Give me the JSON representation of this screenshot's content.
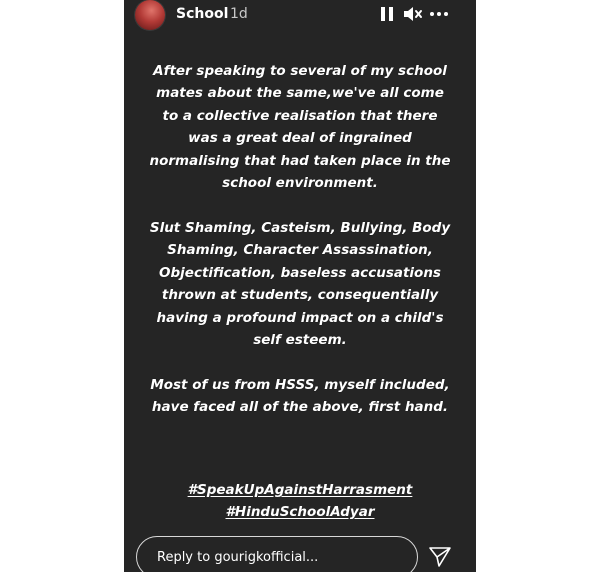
{
  "header": {
    "username": "School",
    "time_ago": "1d",
    "icons": [
      "avatar",
      "pause-icon",
      "mute-icon",
      "more-icon"
    ]
  },
  "story": {
    "paragraphs": [
      "After speaking to several of my school mates about the same,we've all come to a collective realisation that there was a great deal of ingrained normalising that had taken place in the school environment.",
      "Slut Shaming, Casteism, Bullying, Body Shaming, Character Assassination, Objectification, baseless accusations thrown at students, consequentially having a profound impact on a child's self esteem.",
      "Most of us from HSSS, myself included, have faced all of the above, first hand."
    ],
    "hashtags": [
      "#SpeakUpAgainstHarrasment",
      "#HinduSchoolAdyar"
    ]
  },
  "reply": {
    "placeholder": "Reply to gourigkofficial...",
    "send_icon": "send-icon"
  },
  "colors": {
    "story_background": "#252525",
    "page_background": "#ffffff",
    "text": "#ffffff"
  }
}
